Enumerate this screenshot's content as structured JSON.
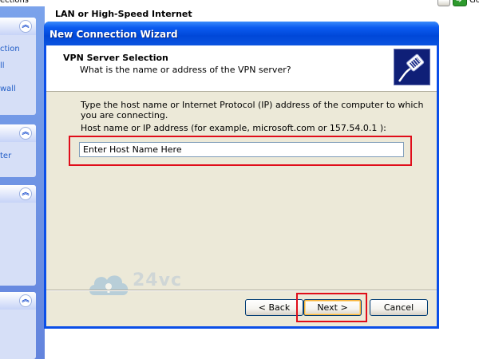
{
  "explorer": {
    "top_crumb": "ections",
    "go_label": "Go",
    "content_header": "LAN or High-Speed Internet",
    "sidebar_links": [
      "ction",
      "ll",
      "wall",
      "ter"
    ]
  },
  "wizard": {
    "title": "New Connection Wizard",
    "header_title": "VPN Server Selection",
    "header_subtitle": "What is the name or address of the VPN server?",
    "instruction": "Type the host name or Internet Protocol (IP) address of the computer to which you are connecting.",
    "field_label": "Host name or IP address (for example, microsoft.com or 157.54.0.1 ):",
    "host_value": "Enter Host Name Here",
    "buttons": {
      "back": "< Back",
      "next": "Next >",
      "cancel": "Cancel"
    },
    "header_icon": "network-plug-icon"
  },
  "watermark": {
    "text": "24vc"
  },
  "colors": {
    "titlebar": "#0047d8",
    "dialog_face": "#ece9d8",
    "highlight": "#e00d1a",
    "sidebar": "#6384dd"
  }
}
